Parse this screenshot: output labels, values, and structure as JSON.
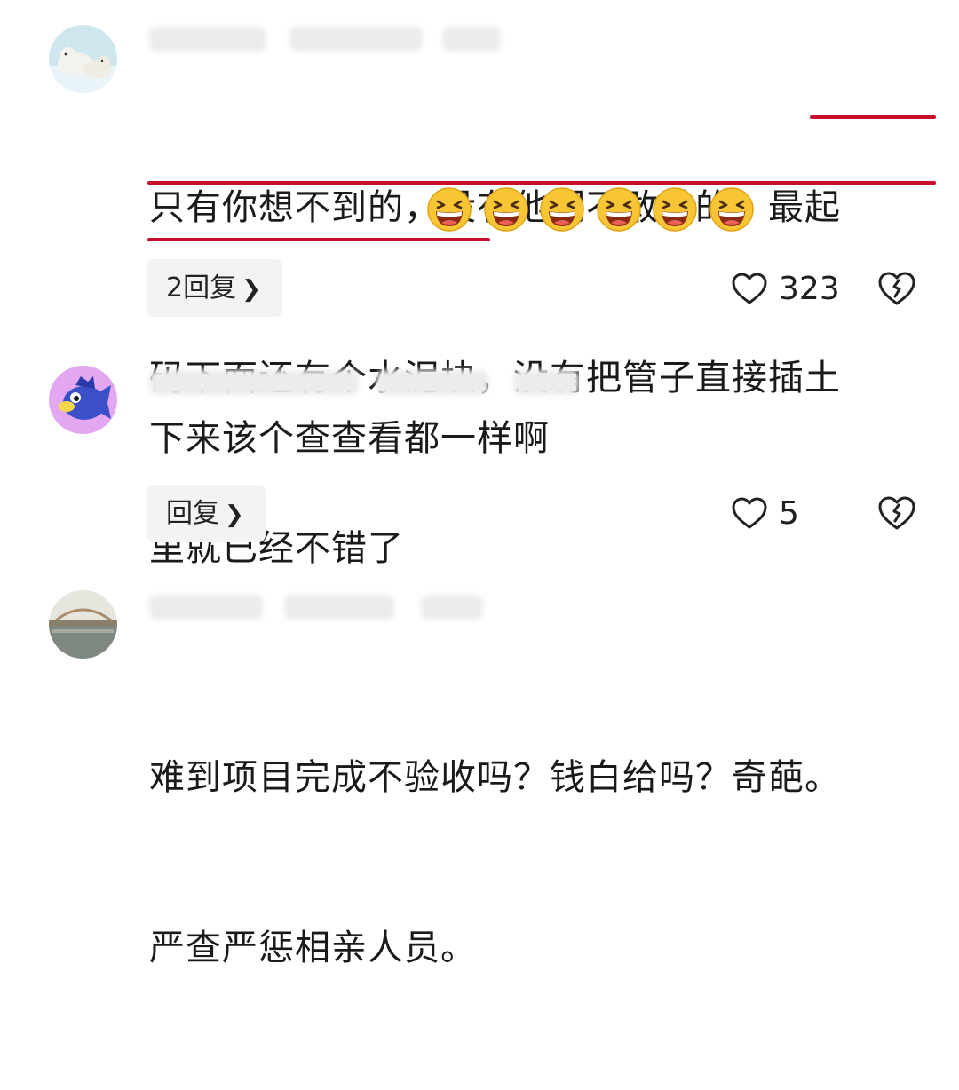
{
  "comments": [
    {
      "text": "只有你想不到的，没有他们不敢做的，最起码下面还有个水泥块，没有把管子直接插土里就已经不错了",
      "line1": "只有你想不到的，没有他们不敢做的，最起",
      "line2": "码下面还有个水泥块，没有把管子直接插土",
      "line3": "里就已经不错了",
      "emoji_count": 6,
      "emoji_icon": "grinning-squint-face-icon",
      "reply_label": "2回复",
      "likes": "323"
    },
    {
      "text": "下来该个查查看都一样啊",
      "reply_label": "回复",
      "likes": "5"
    },
    {
      "line1": "难到项目完成不验收吗？钱白给吗？奇葩。",
      "line2": "严查严惩相亲人员。"
    }
  ],
  "colors": {
    "underline": "#c8102e",
    "reply_bg": "#f3f3f3",
    "emoji": "#f8c534"
  }
}
